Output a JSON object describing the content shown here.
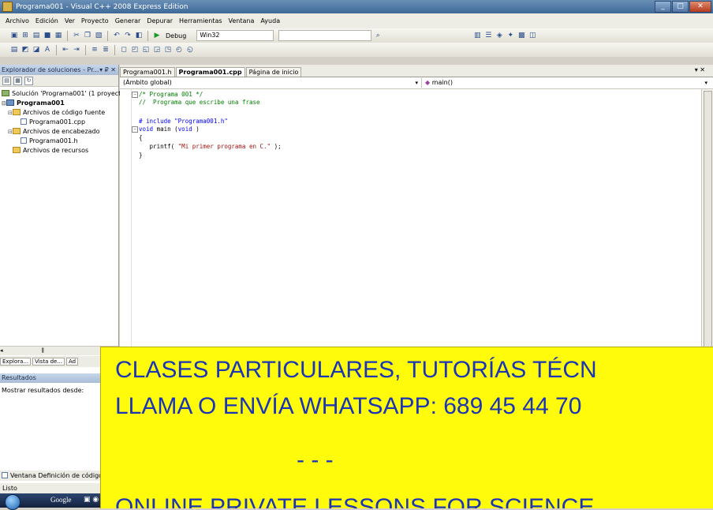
{
  "window": {
    "title": "Programa001 - Visual C++ 2008 Express Edition"
  },
  "menu": [
    "Archivo",
    "Edición",
    "Ver",
    "Proyecto",
    "Generar",
    "Depurar",
    "Herramientas",
    "Ventana",
    "Ayuda"
  ],
  "toolbar": {
    "config": "Debug",
    "platform": "Win32"
  },
  "solution_explorer": {
    "title": "Explorador de soluciones - Pr...",
    "solution": "Solución 'Programa001' (1 proyecto",
    "project": "Programa001",
    "source_folder": "Archivos de código fuente",
    "source_file": "Programa001.cpp",
    "header_folder": "Archivos de encabezado",
    "header_file": "Programa001.h",
    "resource_folder": "Archivos de recursos",
    "bottom_tabs": [
      "Explora...",
      "Vista de...",
      "Ad"
    ]
  },
  "results": {
    "title": "Resultados",
    "show_from": "Mostrar resultados desde:"
  },
  "definition_tab": "Ventana Definición de código",
  "tabs": [
    "Programa001.h",
    "Programa001.cpp",
    "Página de inicio"
  ],
  "nav": {
    "scope": "(Ámbito global)",
    "member": "main()"
  },
  "code": {
    "l1": "/* Programa 001 */",
    "l2": "//  Programa que escribe una frase",
    "l3": "# include \"Programa001.h\"",
    "l4a": "void",
    "l4b": " main (",
    "l4c": "void",
    "l4d": " )",
    "l5": "{",
    "l6a": "   printf( ",
    "l6b": "\"Mi primer programa en C.\"",
    "l6c": " );",
    "l7": "}"
  },
  "status": "Listo",
  "taskbar": {
    "google": "Google"
  },
  "banner": {
    "line1": "CLASES PARTICULARES, TUTORÍAS TÉCN",
    "line2": "LLAMA O ENVÍA WHATSAPP: 689 45 44 70",
    "line3": "- - -",
    "line4": "ONLINE PRIVATE LESSONS FOR SCIENCE"
  }
}
